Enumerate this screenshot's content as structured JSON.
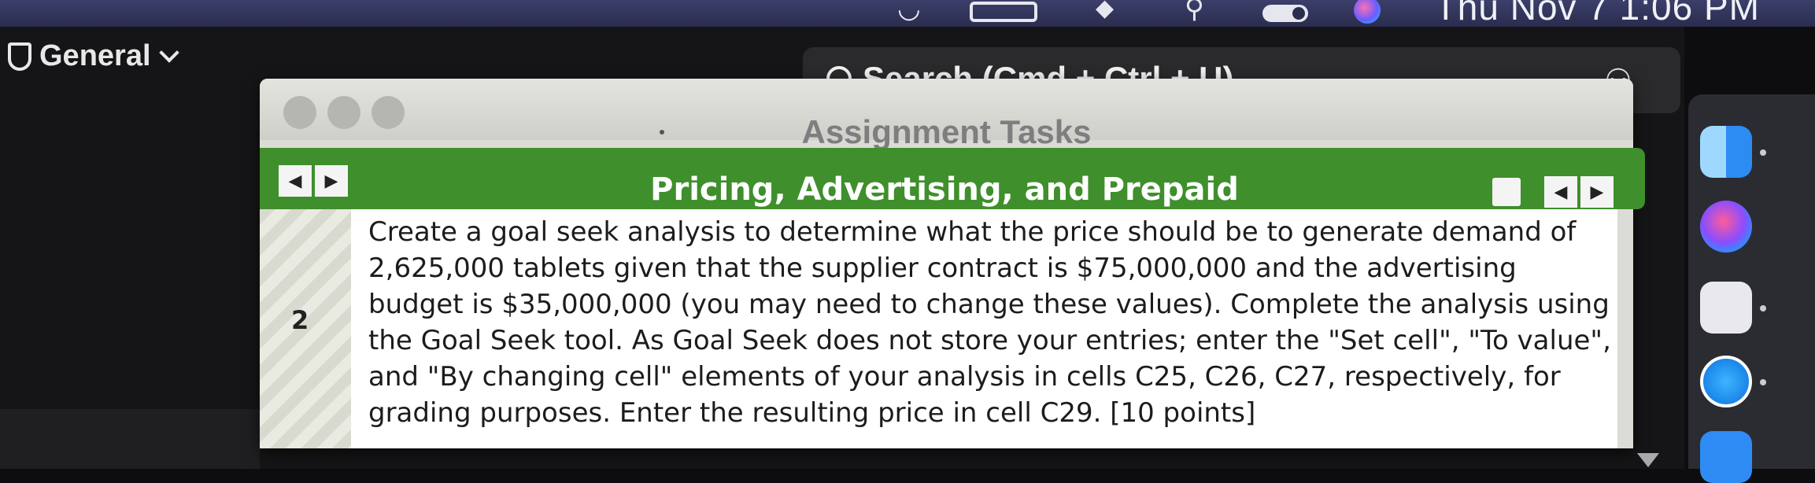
{
  "menubar": {
    "clock": "Thu Nov 7 1:06 PM",
    "icons": [
      "wifi-icon",
      "battery-icon",
      "brightness-icon",
      "search-icon",
      "control-center-icon",
      "siri-icon"
    ]
  },
  "app": {
    "workspace_label": "General",
    "search_placeholder": "Search (Cmd + Ctrl + U)"
  },
  "dialog": {
    "title": "Assignment Tasks",
    "section_heading": "Pricing, Advertising, and Prepaid Contracts",
    "task_number": "2",
    "task_text": "Create a goal seek analysis to determine what the price should be to generate demand of 2,625,000 tablets given that the supplier contract is $75,000,000 and the advertising budget is $35,000,000 (you may need to change these values). Complete the analysis using the Goal Seek tool. As Goal Seek does not store your entries; enter the \"Set cell\", \"To value\", and \"By changing cell\" elements of your analysis in cells C25, C26, C27, respectively, for grading purposes. Enter the resulting price in cell C29.  [10 points]",
    "prev_symbol": "◀",
    "next_symbol": "▶"
  },
  "dock": {
    "apps": [
      "finder-icon",
      "siri-icon",
      "launchpad-icon",
      "safari-icon",
      "mail-icon"
    ]
  },
  "colors": {
    "green": "#3f8f2c",
    "dialog_bg": "#dcdcd6"
  }
}
